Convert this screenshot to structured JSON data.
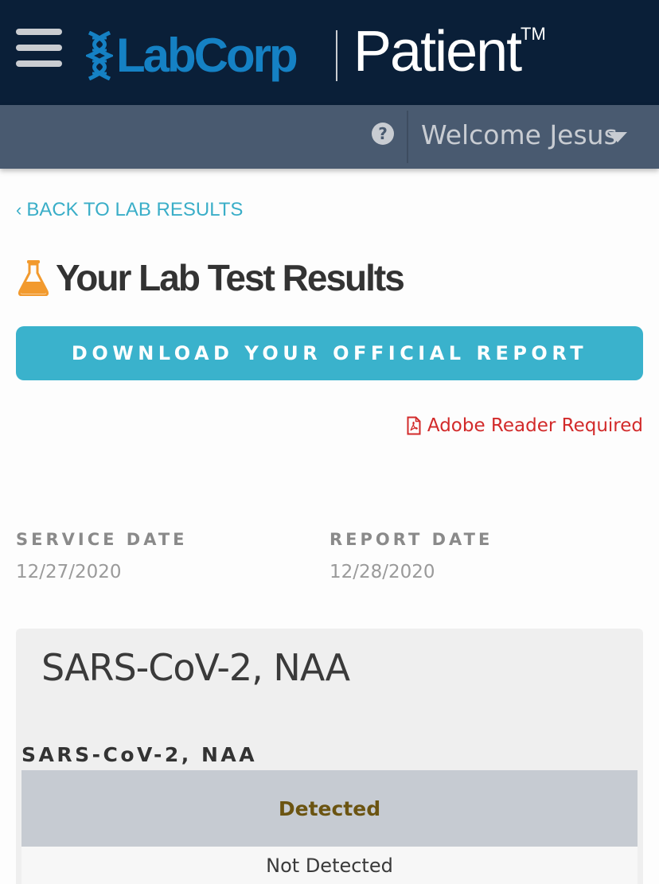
{
  "header": {
    "brand": "LabCorp",
    "product": "Patient",
    "trademark": "TM",
    "menu_icon": "hamburger-menu-icon",
    "logo_icon": "dna-helix-icon"
  },
  "subheader": {
    "help_icon": "question-circle-icon",
    "help_glyph": "?",
    "welcome_text": "Welcome Jesus",
    "dropdown_icon": "caret-down-icon"
  },
  "nav": {
    "back_chevron": "‹",
    "back_label": "BACK TO LAB RESULTS"
  },
  "page": {
    "title": "Your Lab Test Results",
    "title_icon": "flask-icon"
  },
  "actions": {
    "download_label": "DOWNLOAD YOUR OFFICIAL REPORT",
    "adobe_label": "Adobe Reader Required",
    "adobe_icon": "pdf-file-icon"
  },
  "dates": {
    "service_label": "SERVICE DATE",
    "service_value": "12/27/2020",
    "report_label": "REPORT DATE",
    "report_value": "12/28/2020"
  },
  "result": {
    "panel_title": "SARS-CoV-2, NAA",
    "test_name": "SARS-CoV-2, NAA",
    "value": "Detected",
    "reference": "Not Detected"
  },
  "colors": {
    "header_bg": "#0a1f38",
    "subheader_bg": "#495a70",
    "brand_blue": "#1581c4",
    "accent_teal": "#3ab2cc",
    "alert_red": "#d22a2a",
    "flask_orange": "#f29a2e",
    "result_text": "#6b5411"
  }
}
